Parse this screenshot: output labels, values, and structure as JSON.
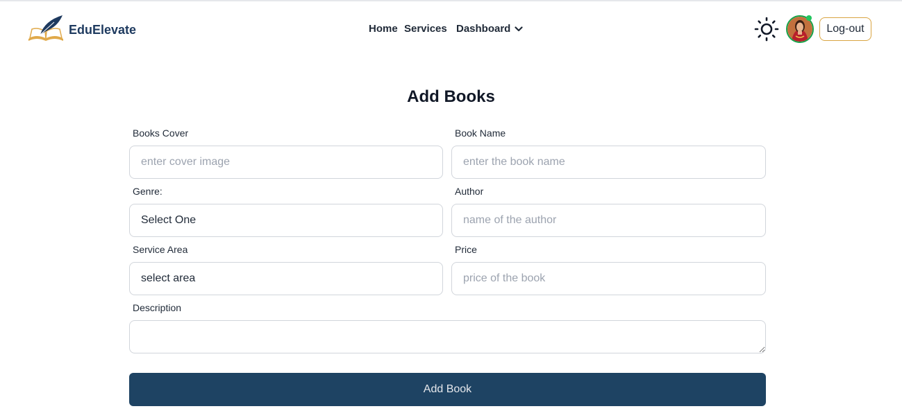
{
  "header": {
    "brand": "EduElevate",
    "nav": {
      "home": "Home",
      "services": "Services",
      "dashboard": "Dashboard"
    },
    "logout_label": "Log-out"
  },
  "form": {
    "title": "Add Books",
    "cover": {
      "label": "Books Cover",
      "placeholder": "enter cover image"
    },
    "name": {
      "label": "Book Name",
      "placeholder": "enter the book name"
    },
    "genre": {
      "label": "Genre:",
      "value": "Select One"
    },
    "author": {
      "label": "Author",
      "placeholder": "name of the author"
    },
    "area": {
      "label": "Service Area",
      "value": "select area"
    },
    "price": {
      "label": "Price",
      "placeholder": "price of the book"
    },
    "description": {
      "label": "Description"
    },
    "submit_label": "Add Book"
  },
  "colors": {
    "brand": "#1e3a5f",
    "button": "#1e4363",
    "logout_border": "#d9a441",
    "online": "#22c55e"
  }
}
